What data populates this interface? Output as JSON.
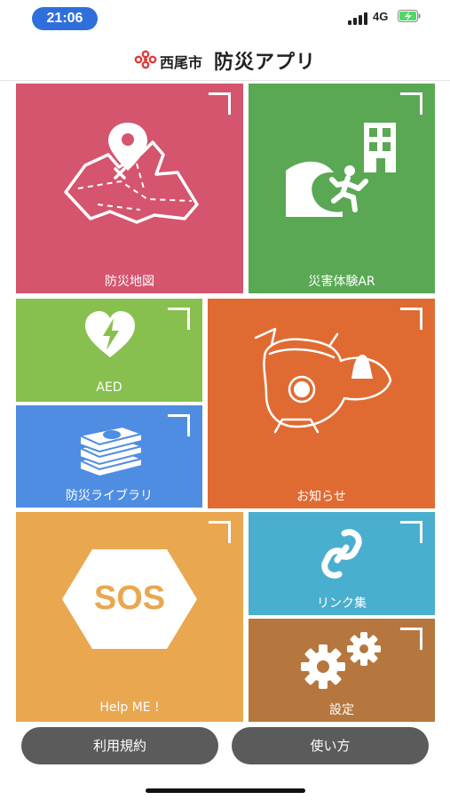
{
  "status_bar": {
    "time": "21:06",
    "network": "4G",
    "time_pill_color": "#2f6fdc"
  },
  "header": {
    "city_name": "西尾市",
    "app_name": "防災アプリ",
    "logo_color": "#e03a3a"
  },
  "tiles": [
    {
      "key": "map",
      "label": "防災地図",
      "color": "#d5546e",
      "icon": "map-pin-icon"
    },
    {
      "key": "ar",
      "label": "災害体験AR",
      "color": "#5aa854",
      "icon": "tsunami-evacuation-icon"
    },
    {
      "key": "aed",
      "label": "AED",
      "color": "#87c04e",
      "icon": "aed-heart-icon"
    },
    {
      "key": "library",
      "label": "防災ライブラリ",
      "color": "#4f8de2",
      "icon": "book-stack-icon"
    },
    {
      "key": "news",
      "label": "お知らせ",
      "color": "#e06b32",
      "icon": "mascot-icon"
    },
    {
      "key": "sos",
      "label": "Help ME !",
      "color": "#e9a750",
      "icon": "sos-hexagon-icon",
      "badge": "SOS"
    },
    {
      "key": "links",
      "label": "リンク集",
      "color": "#4aafce",
      "icon": "chain-link-icon"
    },
    {
      "key": "settings",
      "label": "設定",
      "color": "#b6773e",
      "icon": "gears-icon"
    }
  ],
  "bottom_buttons": {
    "terms": "利用規約",
    "howto": "使い方"
  }
}
